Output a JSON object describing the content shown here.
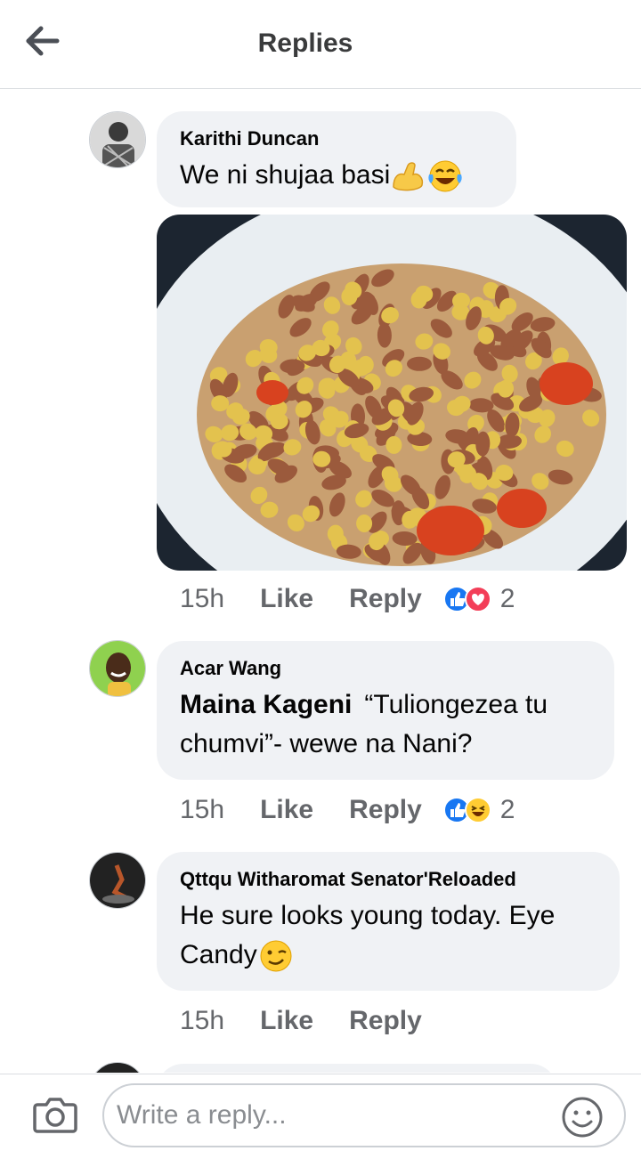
{
  "header": {
    "title": "Replies"
  },
  "comments": [
    {
      "author": "Karithi Duncan",
      "text": "We ni shujaa basi",
      "emojis": [
        "flexed-biceps",
        "tears-of-joy"
      ],
      "time": "15h",
      "like_label": "Like",
      "reply_label": "Reply",
      "reactions": [
        "like",
        "love"
      ],
      "reaction_count": "2",
      "has_photo": true
    },
    {
      "author": "Acar Wang",
      "mention": "Maina Kageni",
      "text": "“Tuliongezea tu chumvi”- wewe na Nani?",
      "time": "15h",
      "like_label": "Like",
      "reply_label": "Reply",
      "reactions": [
        "like",
        "haha"
      ],
      "reaction_count": "2"
    },
    {
      "author": "Qttqu Witharomat Senator'Reloaded",
      "text": "He sure looks young today. Eye Candy",
      "emojis": [
        "winking-face"
      ],
      "time": "15h",
      "like_label": "Like",
      "reply_label": "Reply"
    }
  ],
  "composer": {
    "placeholder": "Write a reply..."
  },
  "colors": {
    "bubble": "#f0f2f5",
    "like_blue": "#1877f2",
    "love_red": "#f33e58",
    "meta_grey": "#65676b"
  }
}
